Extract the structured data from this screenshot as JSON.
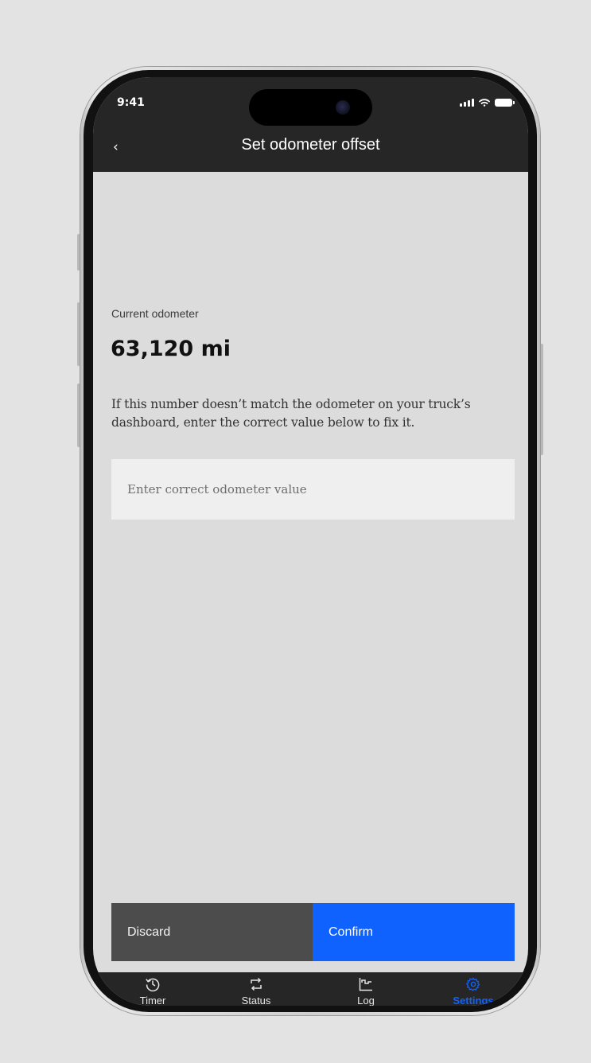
{
  "status_bar": {
    "time": "9:41"
  },
  "header": {
    "back_label": "‹",
    "title": "Set odometer offset"
  },
  "odometer": {
    "label": "Current odometer",
    "value": "63,120 mi",
    "help_text": "If this number doesn’t match the odometer on your truck’s dashboard, enter the correct value below to fix it.",
    "input_placeholder": "Enter correct odometer value",
    "input_value": ""
  },
  "actions": {
    "discard_label": "Discard",
    "confirm_label": "Confirm"
  },
  "tabs": [
    {
      "label": "Timer",
      "icon": "history-icon"
    },
    {
      "label": "Status",
      "icon": "switch-arrows-icon"
    },
    {
      "label": "Log",
      "icon": "step-chart-icon"
    },
    {
      "label": "Settings",
      "icon": "gear-icon",
      "active": true
    }
  ],
  "colors": {
    "accent": "#0f62fe",
    "header_bg": "#262626",
    "screen_bg": "#dcdcdc",
    "discard_bg": "#4c4c4c"
  }
}
